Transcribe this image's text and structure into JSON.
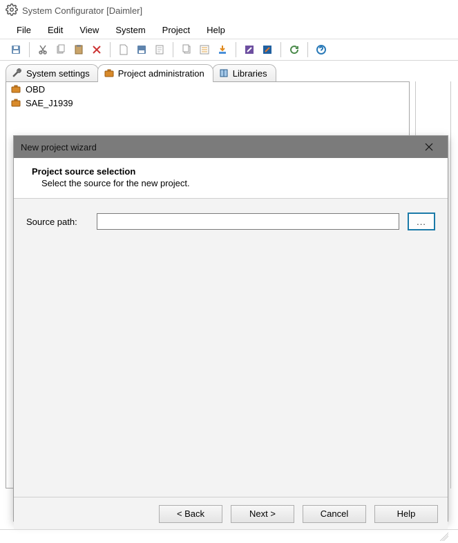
{
  "window": {
    "title": "System Configurator [Daimler]"
  },
  "menu": [
    "File",
    "Edit",
    "View",
    "System",
    "Project",
    "Help"
  ],
  "tabs": [
    {
      "icon": "wrench",
      "label": "System settings",
      "active": false
    },
    {
      "icon": "briefcase",
      "label": "Project administration",
      "active": true
    },
    {
      "icon": "book",
      "label": "Libraries",
      "active": false
    }
  ],
  "tree": [
    {
      "label": "OBD"
    },
    {
      "label": "SAE_J1939"
    }
  ],
  "dialog": {
    "title": "New project wizard",
    "headline": "Project source selection",
    "subline": "Select the source for the new project.",
    "field_label": "Source path:",
    "field_value": "",
    "browse_label": "...",
    "buttons": {
      "back": "< Back",
      "next": "Next >",
      "cancel": "Cancel",
      "help": "Help"
    }
  }
}
